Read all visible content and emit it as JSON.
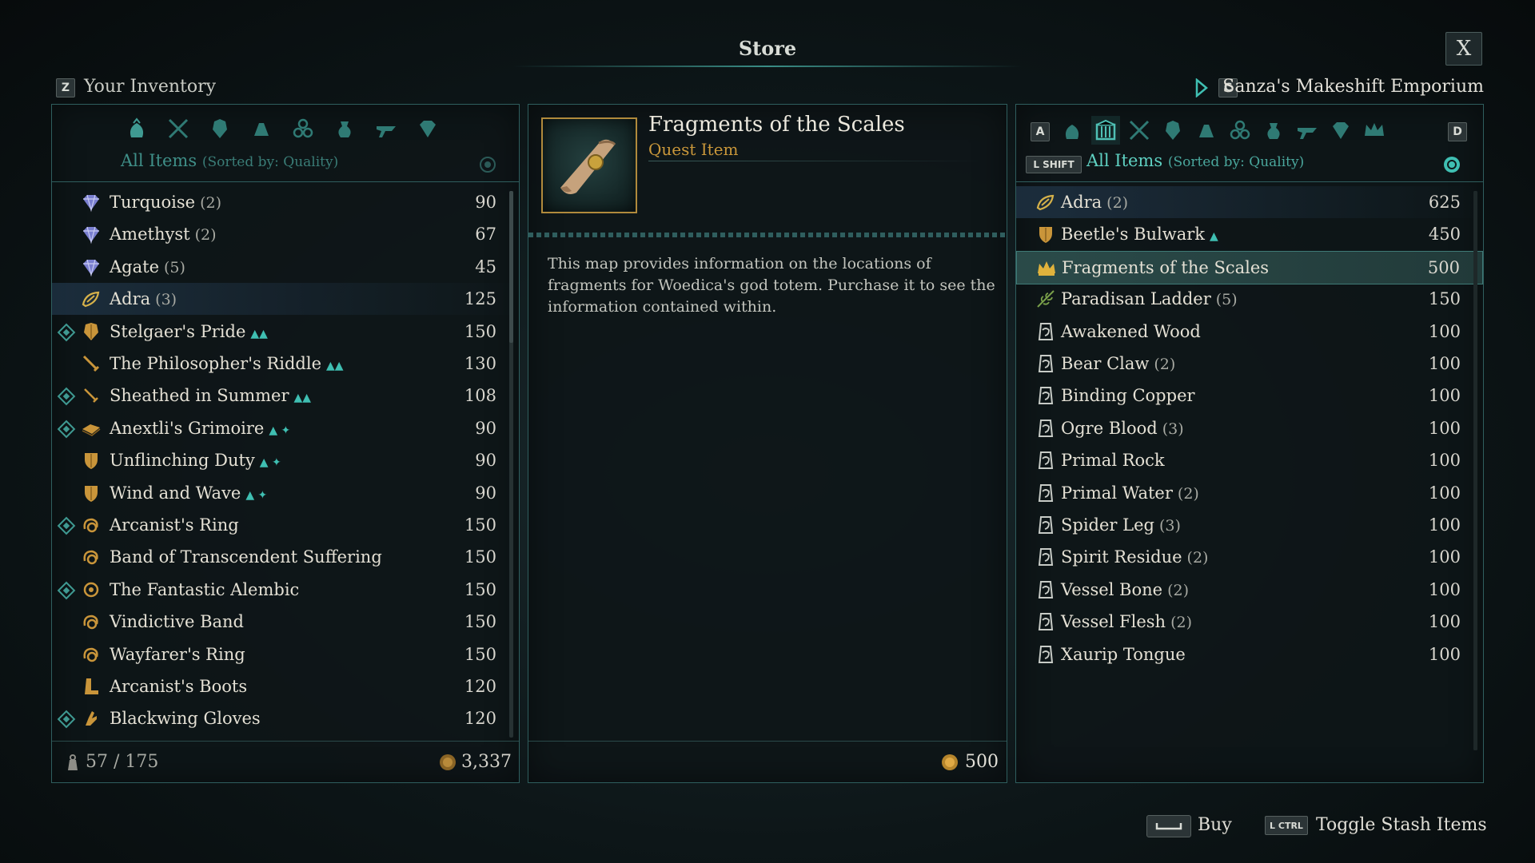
{
  "header": {
    "title": "Store",
    "close_label": "X"
  },
  "inventory": {
    "key": "Z",
    "title": "Your Inventory",
    "filter_label": "All Items",
    "sort_label": "(Sorted by: Quality)",
    "capacity": "57 / 175",
    "money": "3,337",
    "items": [
      {
        "name": "Turquoise",
        "qty": "(2)",
        "price": "90",
        "icon": "gem-icon",
        "marker": false,
        "ench": ""
      },
      {
        "name": "Amethyst",
        "qty": "(2)",
        "price": "67",
        "icon": "gem-icon",
        "marker": false,
        "ench": ""
      },
      {
        "name": "Agate",
        "qty": "(5)",
        "price": "45",
        "icon": "gem-icon",
        "marker": false,
        "ench": ""
      },
      {
        "name": "Adra",
        "qty": "(3)",
        "price": "125",
        "icon": "adra-icon",
        "marker": false,
        "ench": ""
      },
      {
        "name": "Stelgaer's Pride",
        "qty": "",
        "price": "150",
        "icon": "armor-icon",
        "marker": true,
        "ench": "▲▲"
      },
      {
        "name": "The Philosopher's Riddle",
        "qty": "",
        "price": "130",
        "icon": "sword-icon",
        "marker": false,
        "ench": "▲▲"
      },
      {
        "name": "Sheathed in Summer",
        "qty": "",
        "price": "108",
        "icon": "dagger-icon",
        "marker": true,
        "ench": "▲▲"
      },
      {
        "name": "Anextli's Grimoire",
        "qty": "",
        "price": "90",
        "icon": "grimoire-icon",
        "marker": true,
        "ench": "▲ ✦"
      },
      {
        "name": "Unflinching Duty",
        "qty": "",
        "price": "90",
        "icon": "shield-icon",
        "marker": false,
        "ench": "▲ ✦"
      },
      {
        "name": "Wind and Wave",
        "qty": "",
        "price": "90",
        "icon": "shield-icon",
        "marker": false,
        "ench": "▲ ✦"
      },
      {
        "name": "Arcanist's Ring",
        "qty": "",
        "price": "150",
        "icon": "ring-icon",
        "marker": true,
        "ench": ""
      },
      {
        "name": "Band of Transcendent Suffering",
        "qty": "",
        "price": "150",
        "icon": "ring-icon",
        "marker": false,
        "ench": ""
      },
      {
        "name": "The Fantastic Alembic",
        "qty": "",
        "price": "150",
        "icon": "amulet-icon",
        "marker": true,
        "ench": ""
      },
      {
        "name": "Vindictive Band",
        "qty": "",
        "price": "150",
        "icon": "ring-icon",
        "marker": false,
        "ench": ""
      },
      {
        "name": "Wayfarer's Ring",
        "qty": "",
        "price": "150",
        "icon": "ring-icon",
        "marker": false,
        "ench": ""
      },
      {
        "name": "Arcanist's Boots",
        "qty": "",
        "price": "120",
        "icon": "boots-icon",
        "marker": false,
        "ench": ""
      },
      {
        "name": "Blackwing Gloves",
        "qty": "",
        "price": "120",
        "icon": "gloves-icon",
        "marker": true,
        "ench": ""
      }
    ]
  },
  "detail": {
    "name": "Fragments of the Scales",
    "type": "Quest Item",
    "description": "This map provides information on the locations of fragments for Woedica's god totem. Purchase it to see the information contained within.",
    "price": "500"
  },
  "store": {
    "key_prev": "C",
    "name": "Sanza's Makeshift Emporium",
    "key_a": "A",
    "key_d": "D",
    "shift_key": "L SHIFT",
    "filter_label": "All Items",
    "sort_label": "(Sorted by: Quality)",
    "items": [
      {
        "name": "Adra",
        "qty": "(2)",
        "price": "625",
        "icon": "adra-icon",
        "ench": ""
      },
      {
        "name": "Beetle's Bulwark",
        "qty": "",
        "price": "450",
        "icon": "shield-icon",
        "ench": "▲"
      },
      {
        "name": "Fragments of the Scales",
        "qty": "",
        "price": "500",
        "icon": "crown-icon",
        "ench": ""
      },
      {
        "name": "Paradisan Ladder",
        "qty": "(5)",
        "price": "150",
        "icon": "herb-icon",
        "ench": ""
      },
      {
        "name": "Awakened Wood",
        "qty": "",
        "price": "100",
        "icon": "ingredient-icon",
        "ench": ""
      },
      {
        "name": "Bear Claw",
        "qty": "(2)",
        "price": "100",
        "icon": "ingredient-icon",
        "ench": ""
      },
      {
        "name": "Binding Copper",
        "qty": "",
        "price": "100",
        "icon": "ingredient-icon",
        "ench": ""
      },
      {
        "name": "Ogre Blood",
        "qty": "(3)",
        "price": "100",
        "icon": "ingredient-icon",
        "ench": ""
      },
      {
        "name": "Primal Rock",
        "qty": "",
        "price": "100",
        "icon": "ingredient-icon",
        "ench": ""
      },
      {
        "name": "Primal Water",
        "qty": "(2)",
        "price": "100",
        "icon": "ingredient-icon",
        "ench": ""
      },
      {
        "name": "Spider Leg",
        "qty": "(3)",
        "price": "100",
        "icon": "ingredient-icon",
        "ench": ""
      },
      {
        "name": "Spirit Residue",
        "qty": "(2)",
        "price": "100",
        "icon": "ingredient-icon",
        "ench": ""
      },
      {
        "name": "Vessel Bone",
        "qty": "(2)",
        "price": "100",
        "icon": "ingredient-icon",
        "ench": ""
      },
      {
        "name": "Vessel Flesh",
        "qty": "(2)",
        "price": "100",
        "icon": "ingredient-icon",
        "ench": ""
      },
      {
        "name": "Xaurip Tongue",
        "qty": "",
        "price": "100",
        "icon": "ingredient-icon",
        "ench": ""
      }
    ]
  },
  "footer": {
    "buy_label": "Buy",
    "ctrl_key": "L CTRL",
    "toggle_label": "Toggle Stash Items"
  },
  "colors": {
    "accent_teal": "#3f9a92",
    "gold": "#d4a640",
    "panel_border": "#2f5e5e"
  }
}
